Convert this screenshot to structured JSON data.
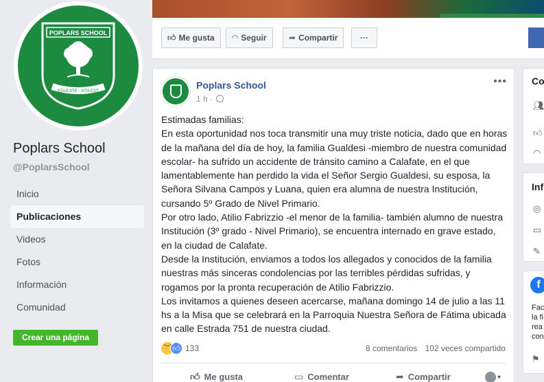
{
  "page": {
    "name": "Poplars School",
    "handle": "@PoplarsSchool",
    "crest_text": "POPLARS SCHOOL",
    "crest_motto": "EDUCATE - VITA EST",
    "nav": [
      {
        "label": "Inicio",
        "active": false
      },
      {
        "label": "Publicaciones",
        "active": true
      },
      {
        "label": "Videos",
        "active": false
      },
      {
        "label": "Fotos",
        "active": false
      },
      {
        "label": "Información",
        "active": false
      },
      {
        "label": "Comunidad",
        "active": false
      }
    ],
    "create_page_label": "Crear una página"
  },
  "actionbar": {
    "like_label": "Me gusta",
    "follow_label": "Seguir",
    "share_label": "Compartir",
    "more_label": "···"
  },
  "post": {
    "author": "Poplars School",
    "time": "1 h ·",
    "more": "•••",
    "paragraphs": [
      "Estimadas familias:",
      "En esta oportunidad nos toca transmitir una muy triste noticia, dado que en horas de la mañana del día de hoy, la familia Gualdesi -miembro de nuestra comunidad escolar- ha sufrido un accidente de tránsito camino a Calafate, en el que lamentablemente han perdido la vida el Señor Sergio Gualdesi, su esposa, la Señora Silvana Campos y Luana, quien era alumna de nuestra Institución, cursando 5º Grado de Nivel Primario.",
      "Por otro lado, Atilio Fabrizzio -el menor de la familia- también alumno de nuestra Institución (3º grado - Nivel Primario), se encuentra internado en grave estado, en la ciudad de Calafate.",
      "Desde la Institución, enviamos a todos los allegados y conocidos de la familia nuestras más sinceras condolencias por las terribles pérdidas sufridas, y rogamos por la pronta recuperación de Atilio Fabrizzio.",
      "Los invitamos a quienes deseen acercarse, mañana domingo 14 de julio a las 11 hs a la Misa que se celebrará en la Parroquia Nuestra Señora de Fátima ubicada en calle Estrada 751 de nuestra ciudad."
    ],
    "reaction_count": "133",
    "comments": "8 comentarios",
    "shares": "102 veces compartido",
    "actions": {
      "like": "Me gusta",
      "comment": "Comentar",
      "share": "Compartir"
    }
  },
  "right": {
    "community_title": "Co",
    "info_title": "Inf",
    "fb_text_lines": [
      "Fac",
      "la fi",
      "rea",
      "con"
    ]
  },
  "colors": {
    "brand_green": "#1c8a3f",
    "link_blue": "#365899",
    "create_green": "#42b72a",
    "fb_blue": "#4267b2"
  }
}
